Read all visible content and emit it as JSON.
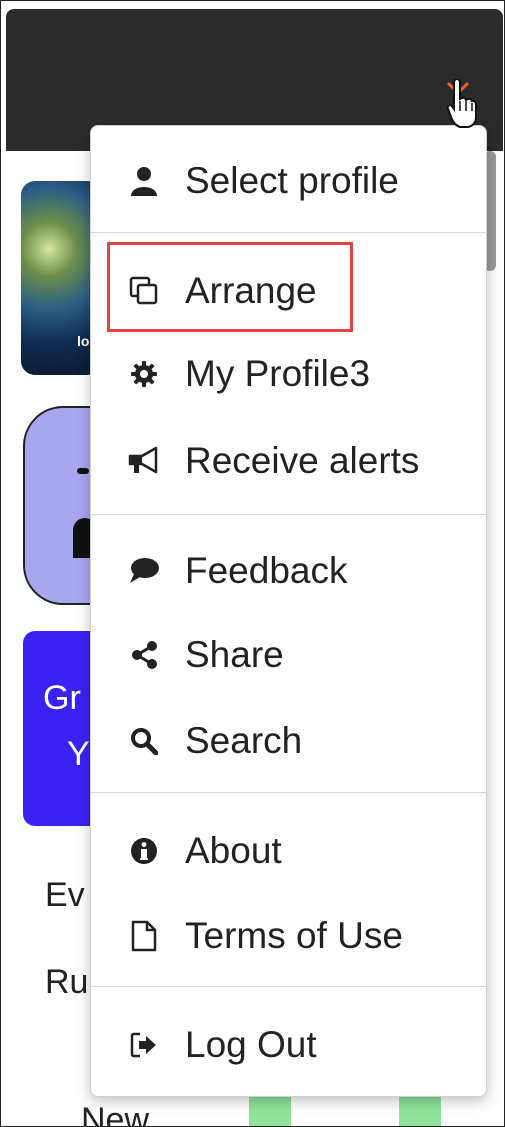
{
  "menu": {
    "items": [
      {
        "label": "Select profile",
        "icon": "user-icon"
      },
      {
        "label": "Arrange",
        "icon": "copy-icon"
      },
      {
        "label": "My Profile3",
        "icon": "gear-icon"
      },
      {
        "label": "Receive alerts",
        "icon": "megaphone-icon"
      },
      {
        "label": "Feedback",
        "icon": "comment-icon"
      },
      {
        "label": "Share",
        "icon": "share-icon"
      },
      {
        "label": "Search",
        "icon": "search-icon"
      },
      {
        "label": "About",
        "icon": "info-icon"
      },
      {
        "label": "Terms of Use",
        "icon": "file-icon"
      },
      {
        "label": "Log Out",
        "icon": "logout-icon"
      }
    ],
    "highlight_color": "#e0443f"
  },
  "background": {
    "thumb_label": "lo",
    "button_line1": "Gr",
    "button_line2": "Y",
    "row1": "Ev",
    "row2": "Ru",
    "row3": "New",
    "accent_purple": "#3b22f3",
    "accent_green": "#8fe39b"
  }
}
